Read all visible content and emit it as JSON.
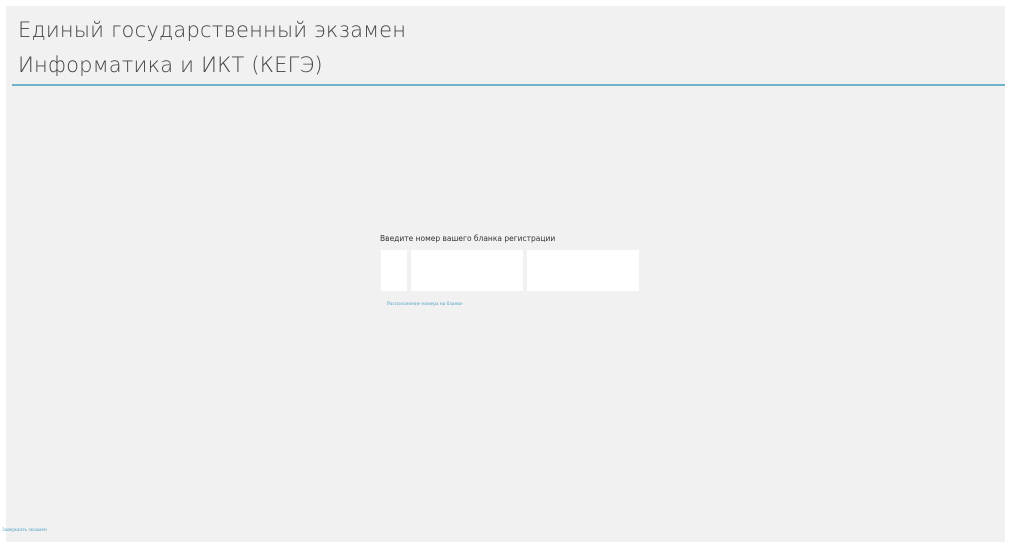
{
  "header": {
    "exam_title": "Единый государственный экзамен",
    "subject_title": "Информатика и ИКТ (КЕГЭ)"
  },
  "registration": {
    "prompt": "Введите номер вашего бланка регистрации",
    "fields": [
      {
        "value": ""
      },
      {
        "value": ""
      },
      {
        "value": ""
      }
    ],
    "help_link": "Расположение номера на бланке"
  },
  "footer": {
    "finish_label": "Завершить экзамен"
  },
  "colors": {
    "background": "#f1f1f1",
    "accent_line": "#6eb3c8",
    "link": "#5aa6c8"
  }
}
